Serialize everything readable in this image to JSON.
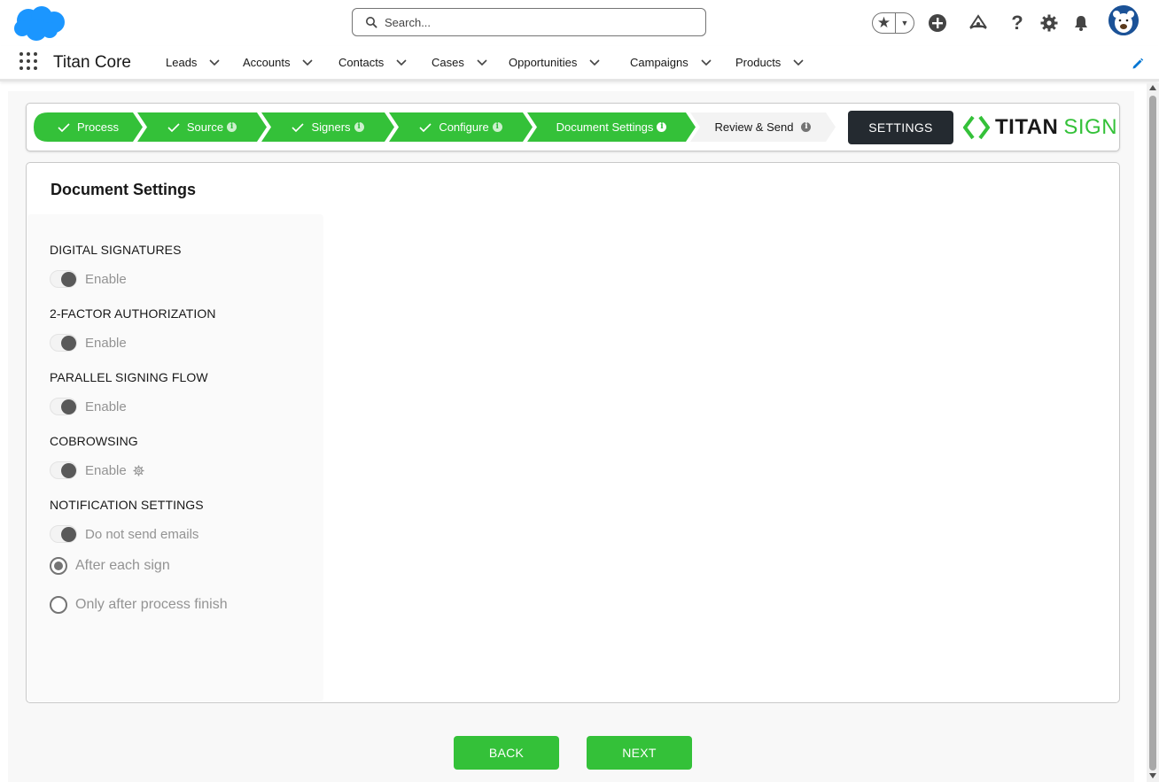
{
  "header": {
    "search": {
      "placeholder": "Search..."
    },
    "icons": [
      "favorites-star-icon",
      "favorites-dropdown-icon",
      "global-create-icon",
      "trailhead-icon",
      "help-icon",
      "setup-gear-icon",
      "notifications-bell-icon",
      "user-avatar"
    ]
  },
  "nav": {
    "app_name": "Titan Core",
    "items": [
      {
        "label": "Leads"
      },
      {
        "label": "Accounts"
      },
      {
        "label": "Contacts"
      },
      {
        "label": "Cases"
      },
      {
        "label": "Opportunities"
      },
      {
        "label": "Campaigns"
      },
      {
        "label": "Products"
      }
    ]
  },
  "path": {
    "steps": [
      {
        "label": "Process",
        "status": "complete",
        "info": false
      },
      {
        "label": "Source",
        "status": "complete",
        "info": true
      },
      {
        "label": "Signers",
        "status": "complete",
        "info": true
      },
      {
        "label": "Configure",
        "status": "complete",
        "info": true
      },
      {
        "label": "Document Settings",
        "status": "current",
        "info": true
      },
      {
        "label": "Review & Send",
        "status": "pending",
        "info": true
      }
    ],
    "settings_label": "SETTINGS",
    "logo": {
      "word_a": "TITAN",
      "word_b": "SIGN"
    }
  },
  "card": {
    "title": "Document Settings",
    "sections": {
      "digital_signatures": {
        "label": "DIGITAL SIGNATURES",
        "toggle_label": "Enable",
        "enabled": false
      },
      "two_factor": {
        "label": "2-FACTOR AUTHORIZATION",
        "toggle_label": "Enable",
        "enabled": false
      },
      "parallel_signing": {
        "label": "PARALLEL SIGNING FLOW",
        "toggle_label": "Enable",
        "enabled": false
      },
      "cobrowsing": {
        "label": "COBROWSING",
        "toggle_label": "Enable",
        "enabled": false
      },
      "notifications": {
        "label": "NOTIFICATION SETTINGS",
        "toggle_label": "Do not send emails",
        "enabled": false,
        "options": [
          {
            "label": "After each sign",
            "selected": true
          },
          {
            "label": "Only after process finish",
            "selected": false
          }
        ]
      }
    }
  },
  "footer": {
    "back_label": "BACK",
    "next_label": "NEXT"
  },
  "colors": {
    "accent_green": "#34c139",
    "dark_button": "#242a30",
    "salesforce_blue": "#1b96ff",
    "edit_blue": "#0176d3"
  }
}
